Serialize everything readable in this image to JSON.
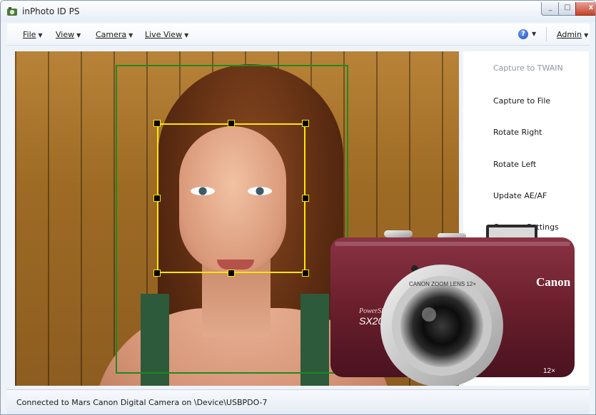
{
  "window": {
    "title": "inPhoto ID PS",
    "close": "x"
  },
  "menu": {
    "items": [
      {
        "label": "File"
      },
      {
        "label": "View"
      },
      {
        "label": "Camera"
      },
      {
        "label": "Live View"
      }
    ],
    "help": "?",
    "admin": "Admin"
  },
  "actions": [
    {
      "label": "Capture to TWAIN",
      "enabled": false
    },
    {
      "label": "Capture to File",
      "enabled": true
    },
    {
      "label": "Rotate Right",
      "enabled": true
    },
    {
      "label": "Rotate Left",
      "enabled": true
    },
    {
      "label": "Update AE/AF",
      "enabled": true
    },
    {
      "label": "Camera Settings",
      "enabled": true
    }
  ],
  "camera": {
    "brand": "Canon",
    "model_line": "PowerShot",
    "model": "SX200",
    "zoom_badge": "12×",
    "lens_text": "CANON ZOOM LENS 12×"
  },
  "status": {
    "text": "Connected to Mars Canon Digital Camera on \\Device\\USBPDO-7"
  },
  "colors": {
    "accent": "#1f4fb8",
    "crop_outer": "#1f8a1f",
    "crop_face": "#ffe600",
    "camera_body": "#6a1f2c"
  },
  "icons": {
    "app": "app-icon",
    "help": "help-icon",
    "minimize": "minimize-icon",
    "maximize": "maximize-icon",
    "close": "close-icon"
  }
}
